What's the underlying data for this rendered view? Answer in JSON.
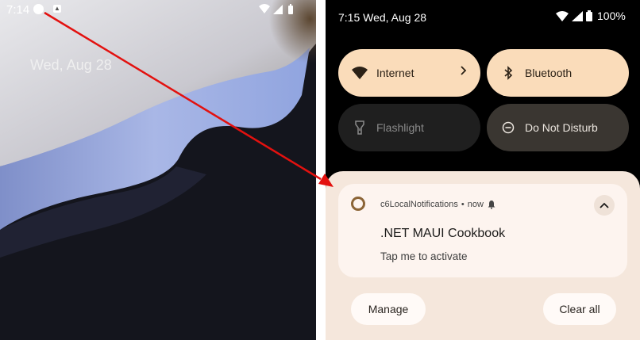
{
  "left_screen": {
    "status_time": "7:14",
    "status_icons": [
      "notification-dot-icon",
      "app-notification-icon",
      "wifi-icon",
      "signal-icon",
      "battery-icon"
    ],
    "date": "Wed, Aug 28"
  },
  "right_screen": {
    "status_time": "7:15 Wed, Aug 28",
    "battery_percent": "100%",
    "quick_settings": [
      {
        "label": "Internet",
        "icon": "wifi-icon",
        "state": "on",
        "has_chevron": true
      },
      {
        "label": "Bluetooth",
        "icon": "bluetooth-icon",
        "state": "on"
      },
      {
        "label": "Flashlight",
        "icon": "flashlight-icon",
        "state": "off"
      },
      {
        "label": "Do Not Disturb",
        "icon": "do-not-disturb-icon",
        "state": "off"
      }
    ],
    "notification": {
      "app_name": "c6LocalNotifications",
      "separator": "•",
      "time": "now",
      "title": ".NET MAUI Cookbook",
      "body": "Tap me to activate"
    },
    "actions": {
      "manage": "Manage",
      "clear_all": "Clear all"
    }
  },
  "colors": {
    "tile_on": "#fadcba",
    "tile_off": "#1f1f1f",
    "tile_dnd": "#3a3631",
    "panel": "#f5e7dc",
    "card": "#fdf4ef",
    "arrow": "#e3110f"
  }
}
